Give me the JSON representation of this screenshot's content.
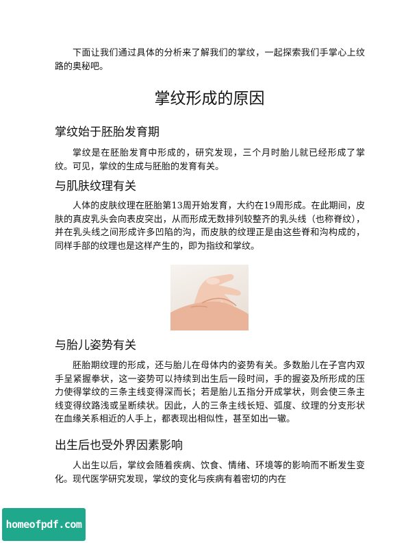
{
  "intro": "下面让我们通过具体的分析来了解我们的掌纹，一起探索我们手掌心上纹路的奥秘吧。",
  "title": "掌纹形成的原因",
  "sections": [
    {
      "heading": "掌纹始于胚胎发育期",
      "body": "掌纹是在胚胎发育中形成的，研究发现，三个月时胎儿就已经形成了掌纹。可见，掌纹的生成与胚胎的发育有关。"
    },
    {
      "heading": "与肌肤纹理有关",
      "body": "人体的皮肤纹理在胚胎第13周开始发育，大约在19周形成。在此期间，皮肤的真皮乳头会向表皮突出，从而形成无数排列较整齐的乳头线（也称脊纹），并在乳头线之间形成许多凹陷的沟，而皮肤的纹理正是由这些脊和沟构成的，同样手部的纹理也是这样产生的，即为指纹和掌纹。"
    },
    {
      "heading": "与胎儿姿势有关",
      "body": "胚胎期纹理的形成，还与胎儿在母体内的姿势有关。多数胎儿在子宫内双手呈紧握拳状，这一姿势可以持续到出生后一段时间，手的握姿及所形成的压力使得掌纹的三条主线变得深而长；若是胎儿五指分开成掌状，则会使三条主线变得纹路浅或呈断续状。因此，人的三条主线长短、弧度、纹理的分支形状在血缘关系相近的人手上，都表现出相似性，甚至如出一辙。"
    },
    {
      "heading": "出生后也受外界因素影响",
      "body": "人出生以后，掌纹会随着疾病、饮食、情绪、环境等的影响而不断发生变化。现代医学研究发现，掌纹的变化与疾病有着密切的内在"
    }
  ],
  "watermark": "homeofpdf.com"
}
